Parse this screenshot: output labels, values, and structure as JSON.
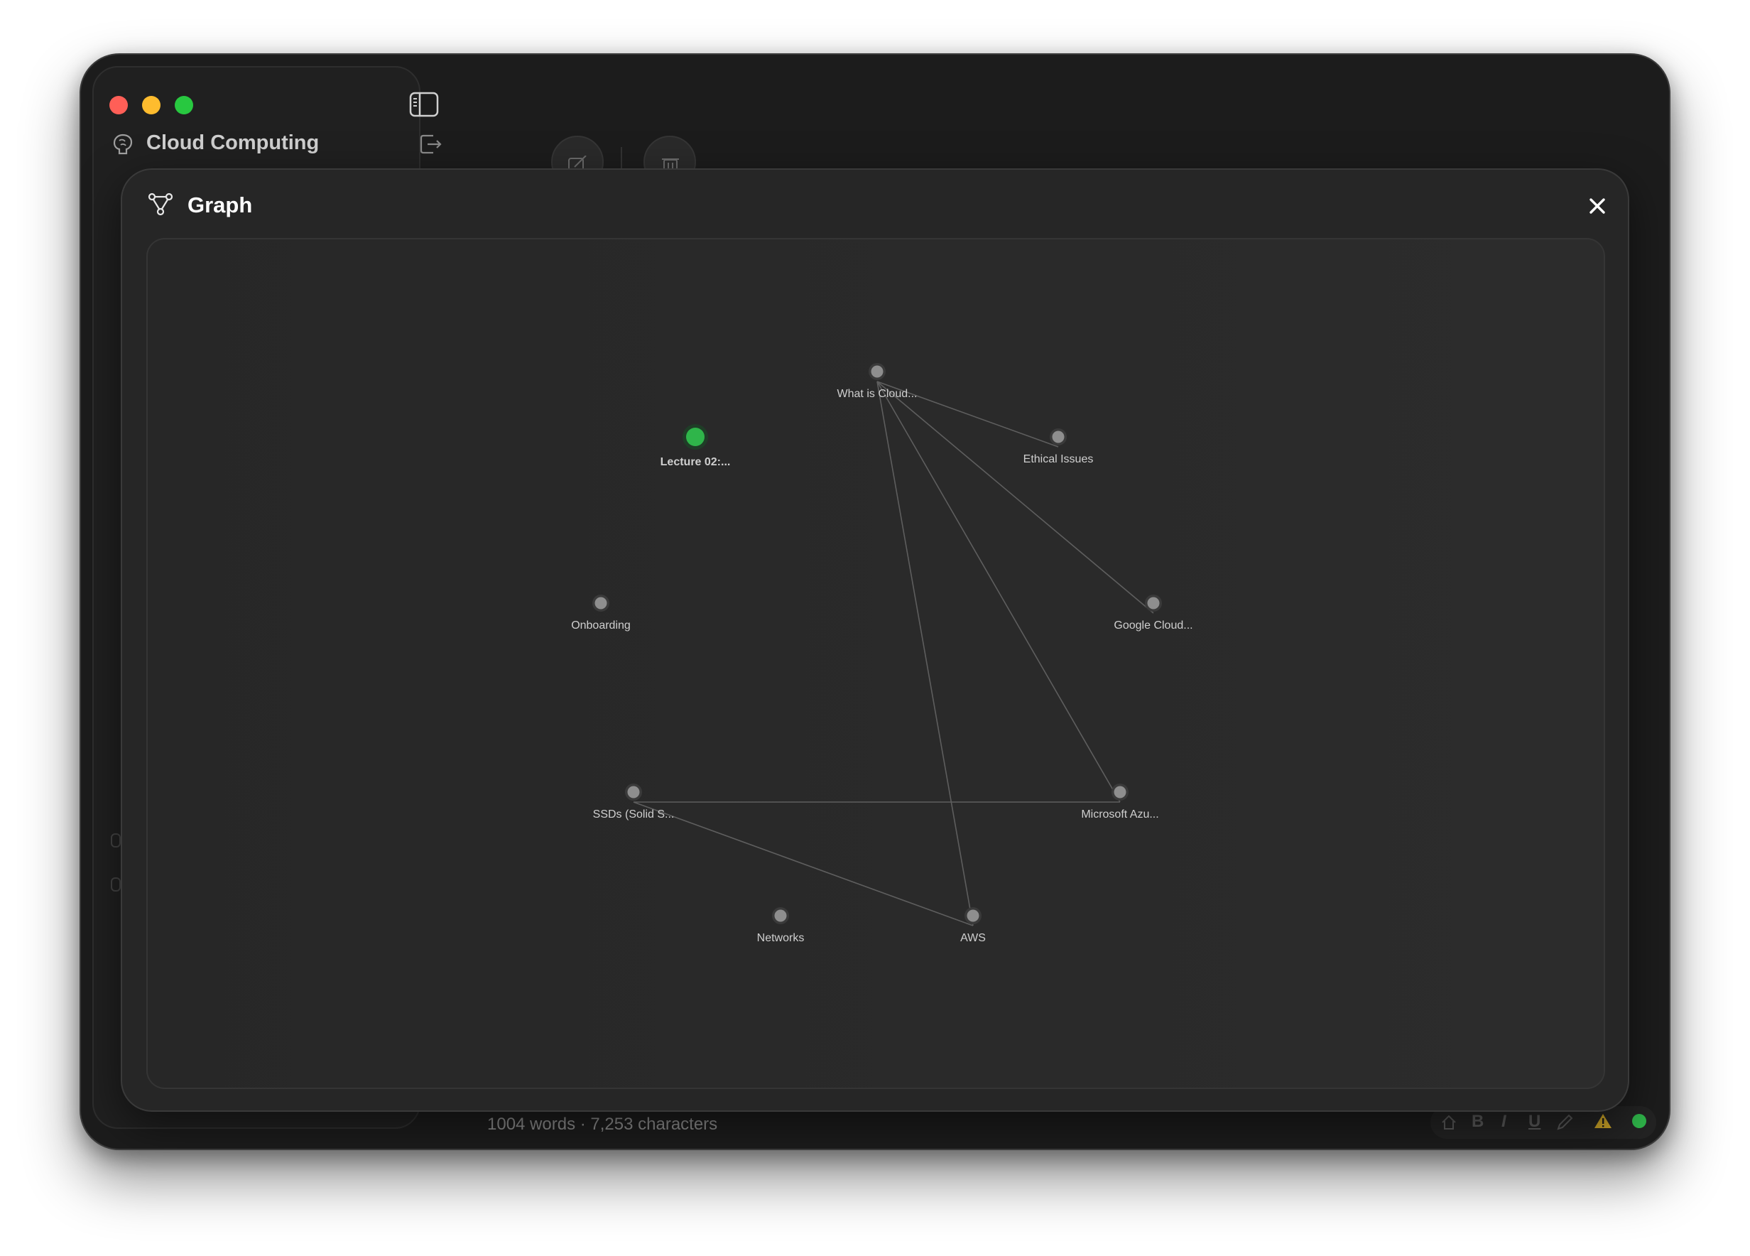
{
  "sidebar": {
    "notebook_title": "Cloud Computing"
  },
  "modal": {
    "title": "Graph"
  },
  "footer": {
    "word_count": "1004 words · 7,253 characters",
    "format_buttons": [
      "B",
      "I",
      "U"
    ]
  },
  "colors": {
    "active_node": "#2fb54a",
    "node": "#8e8e8e",
    "edge": "#5e5e5e"
  },
  "graph": {
    "nodes": [
      {
        "id": "what-is-cloud",
        "label": "What is Cloud...",
        "active": false
      },
      {
        "id": "lecture-02",
        "label": "Lecture 02:...",
        "active": true
      },
      {
        "id": "ethical-issues",
        "label": "Ethical Issues",
        "active": false
      },
      {
        "id": "onboarding",
        "label": "Onboarding",
        "active": false
      },
      {
        "id": "google-cloud",
        "label": "Google Cloud...",
        "active": false
      },
      {
        "id": "ssds",
        "label": "SSDs (Solid S...",
        "active": false
      },
      {
        "id": "microsoft-azure",
        "label": "Microsoft Azu...",
        "active": false
      },
      {
        "id": "networks",
        "label": "Networks",
        "active": false
      },
      {
        "id": "aws",
        "label": "AWS",
        "active": false
      }
    ],
    "edges": [
      [
        "what-is-cloud",
        "ethical-issues"
      ],
      [
        "what-is-cloud",
        "google-cloud"
      ],
      [
        "what-is-cloud",
        "microsoft-azure"
      ],
      [
        "what-is-cloud",
        "aws"
      ],
      [
        "ssds",
        "microsoft-azure"
      ],
      [
        "ssds",
        "aws"
      ]
    ]
  }
}
